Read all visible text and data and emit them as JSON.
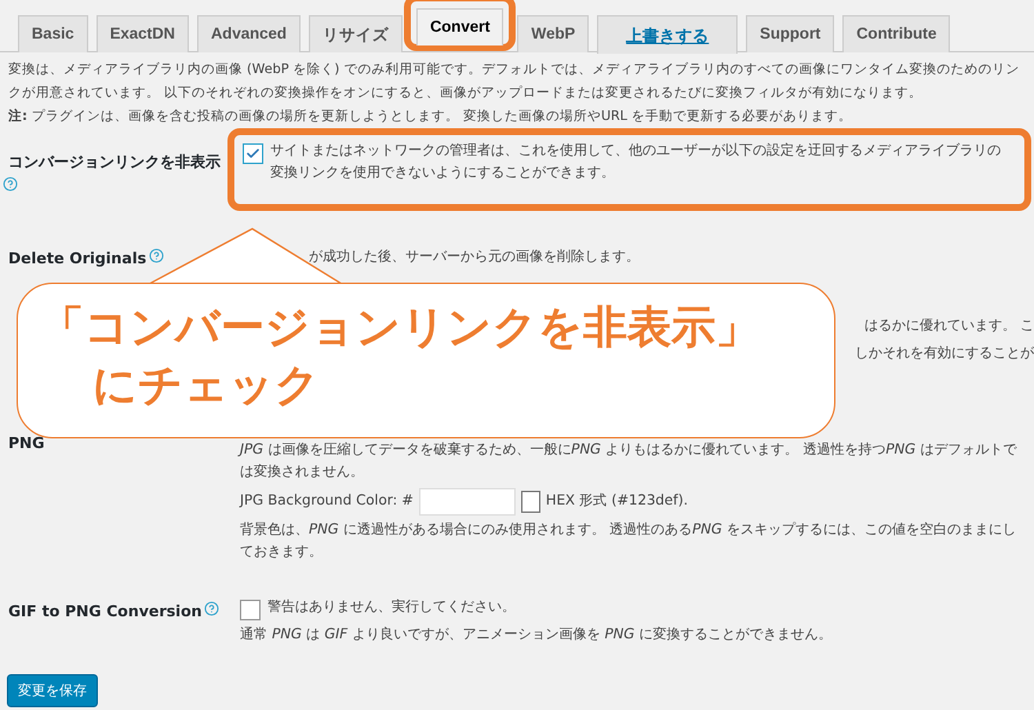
{
  "tabs": [
    {
      "label": "Basic",
      "kind": "tab",
      "selected": false
    },
    {
      "label": "ExactDN",
      "kind": "tab",
      "selected": false
    },
    {
      "label": "Advanced",
      "kind": "tab",
      "selected": false
    },
    {
      "label": "リサイズ",
      "kind": "tab",
      "selected": false
    },
    {
      "label": "Convert",
      "kind": "tab",
      "selected": true
    },
    {
      "label": "WebP",
      "kind": "tab",
      "selected": false
    },
    {
      "label": "上書きする",
      "kind": "link",
      "selected": false
    },
    {
      "label": "Support",
      "kind": "tab",
      "selected": false
    },
    {
      "label": "Contribute",
      "kind": "tab",
      "selected": false
    }
  ],
  "intro": [
    "変換は、メディアライブラリ内の画像 (WebP を除く) でのみ利用可能です。デフォルトでは、メディアライブラリ内のすべての画像にワンタイム変換のためのリンクが用意されています。 以下のそれぞれの変換操作をオンにすると、画像がアップロードまたは変更されるたびに変換フィルタが有効になります。",
    "**注:** プラグインは、画像を含む投稿の画像の場所を更新しようとします。 変換した画像の場所やURL を手動で更新する必要があります。"
  ],
  "settings": [
    {
      "kind": "checkbox",
      "label": "コンバージョンリンクを非表示",
      "help": true,
      "checked": true,
      "text": "サイトまたはネットワークの管理者は、これを使用して、他のユーザーが以下の設定を迂回するメディアライブラリの変換リンクを使用できないようにすることができます。"
    },
    {
      "kind": "partial",
      "label": "Delete Originals",
      "help": true,
      "lines": [
        "が成功した後、サーバーから元の画像を削除します。"
      ]
    },
    {
      "kind": "partial",
      "lines": [
        "はるかに優れています。 こ",
        "しかそれを有効にすることが"
      ]
    },
    {
      "kind": "color",
      "label": "PNG",
      "description": [
        {
          "text": "JPG",
          "italic": true
        },
        {
          "text": " は画像を圧縮してデータを破棄するため、一般に",
          "italic": false
        },
        {
          "text": "PNG",
          "italic": true
        },
        {
          "text": " よりもはるかに優れています。 透過性を持つ",
          "italic": false
        },
        {
          "text": "PNG",
          "italic": true
        },
        {
          "text": " はデフォルトでは変換されません。",
          "italic": false
        }
      ],
      "field_label": "JPG Background Color: #",
      "swatch_hint": "HEX 形式 (#123def).",
      "note": [
        {
          "text": "背景色は、",
          "italic": false
        },
        {
          "text": "PNG",
          "italic": true
        },
        {
          "text": " に透過性がある場合にのみ使用されます。 透過性のある",
          "italic": false
        },
        {
          "text": "PNG",
          "italic": true
        },
        {
          "text": " をスキップするには、この値を空白のままにしておきます。",
          "italic": false
        }
      ]
    },
    {
      "kind": "checkbox",
      "label": "GIF to PNG Conversion",
      "help": true,
      "checked": false,
      "text": "警告はありません、実行してください。",
      "description": "通常 *PNG* は *GIF* より良いですが、アニメーション画像を *PNG* に変換することができません。"
    }
  ],
  "save_button": "変更を保存",
  "callout": {
    "lines": [
      "「コンバージョンリンクを非表示」",
      "にチェック"
    ]
  }
}
